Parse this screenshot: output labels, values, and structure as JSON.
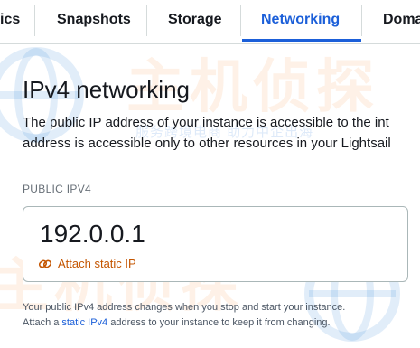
{
  "tabs": [
    {
      "label": "ics"
    },
    {
      "label": "Snapshots"
    },
    {
      "label": "Storage"
    },
    {
      "label": "Networking"
    },
    {
      "label": "Doma"
    }
  ],
  "section": {
    "title": "IPv4 networking",
    "description_line1": "The public IP address of your instance is accessible to the int",
    "description_line2": "address is accessible only to other resources in your Lightsail"
  },
  "public_ipv4": {
    "label": "PUBLIC IPV4",
    "value": "192.0.0.1",
    "attach_label": "Attach static IP",
    "attach_icon": "link-icon"
  },
  "note": {
    "line1": "Your public IPv4 address changes when you stop and start your instance.",
    "line2_before": "Attach a",
    "line2_link": "static IPv4",
    "line2_after": "address to your instance to keep it from changing."
  },
  "watermark": {
    "main": "主机侦探",
    "sub": "服务跨境电商 助力中企出海"
  },
  "colors": {
    "active_tab": "#1b5fd9",
    "accent_orange": "#c45500",
    "link": "#1b5fd9"
  }
}
